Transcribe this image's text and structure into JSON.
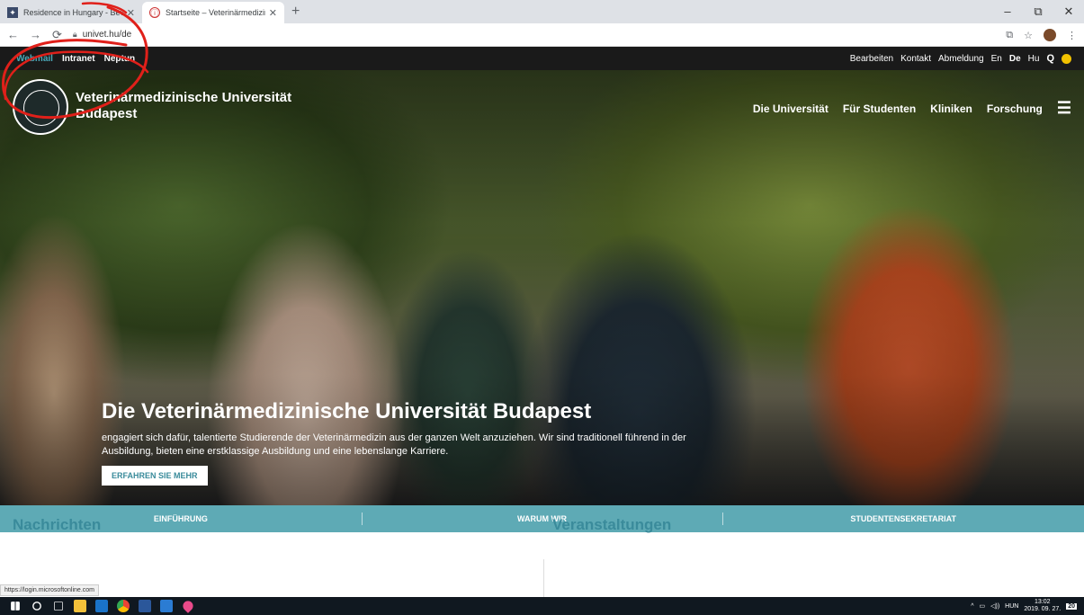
{
  "browser": {
    "tabs": [
      {
        "title": "Residence in Hungary - Bevándorlási és Menekültügyi Hivatal",
        "active": false
      },
      {
        "title": "Startseite – Veterinärmedizinische Universität Budapest",
        "active": true
      }
    ],
    "url": "univet.hu/de",
    "window_controls": [
      "–",
      "⧉",
      "✕"
    ]
  },
  "site": {
    "topbar": {
      "left_links": [
        "Webmail",
        "Intranet",
        "Neptun"
      ],
      "right_links": [
        "Bearbeiten",
        "Kontakt",
        "Abmeldung"
      ],
      "langs": [
        "En",
        "De",
        "Hu"
      ]
    },
    "brand_line1": "Veterinärmedizinische Universität",
    "brand_line2": "Budapest",
    "main_nav": [
      "Die Universität",
      "Für Studenten",
      "Kliniken",
      "Forschung"
    ],
    "hero": {
      "title": "Die Veterinärmedizinische Universität Budapest",
      "desc": "engagiert sich dafür, talentierte Studierende der Veterinärmedizin aus der ganzen Welt anzuziehen. Wir sind traditionell führend in der Ausbildung, bieten eine erstklassige Ausbildung und eine lebenslange Karriere.",
      "cta": "ERFAHREN SIE MEHR"
    },
    "quicklinks": [
      "EINFÜHRUNG",
      "WARUM WIR",
      "STUDENTENSEKRETARIAT"
    ],
    "sections": {
      "news": "Nachrichten",
      "events": "Veranstaltungen"
    },
    "status_url": "https://login.microsoftonline.com"
  },
  "taskbar": {
    "tray_lang": "HUN",
    "time": "13:02",
    "date": "2019. 09. 27.",
    "notif_count": "20"
  },
  "colors": {
    "teal": "#5eaab5",
    "teal_text": "#3a8b9b",
    "annotation": "#e0201a"
  }
}
